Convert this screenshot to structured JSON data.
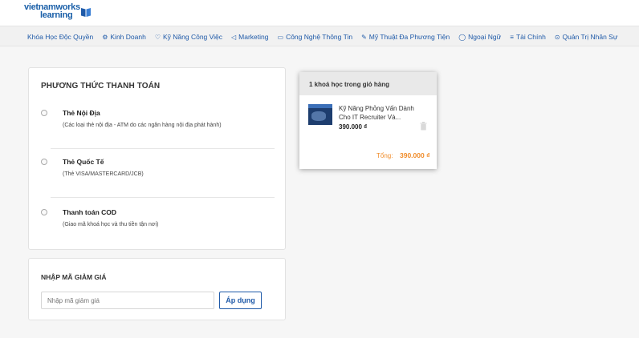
{
  "logo": {
    "line1": "vietnamworks",
    "line2": "learning"
  },
  "nav": {
    "items": [
      {
        "label": "Khóa Học Độc Quyền",
        "icon": ""
      },
      {
        "label": "Kinh Doanh",
        "icon": "⚙"
      },
      {
        "label": "Kỹ Năng Công Việc",
        "icon": "♡"
      },
      {
        "label": "Marketing",
        "icon": "◁"
      },
      {
        "label": "Công Nghệ Thông Tin",
        "icon": "▭"
      },
      {
        "label": "Mỹ Thuật Đa Phương Tiện",
        "icon": "✎"
      },
      {
        "label": "Ngoại Ngữ",
        "icon": "◯"
      },
      {
        "label": "Tài Chính",
        "icon": "≡"
      },
      {
        "label": "Quản Trị Nhân Sự",
        "icon": "⊙"
      }
    ]
  },
  "payment": {
    "title": "PHƯƠNG THỨC THANH TOÁN",
    "options": [
      {
        "label": "Thẻ Nội Địa",
        "desc": "(Các loại thẻ nội địa - ATM do các ngân hàng nội địa phát hành)",
        "selected": false
      },
      {
        "label": "Thẻ Quốc Tế",
        "desc": "(Thẻ VISA/MASTERCARD/JCB)",
        "selected": false
      },
      {
        "label": "Thanh toán COD",
        "desc": "(Giao mã khoá học và thu tiền tận nơi)",
        "selected": false
      }
    ]
  },
  "coupon": {
    "title": "NHẬP MÃ GIẢM GIÁ",
    "placeholder": "Nhập mã giảm giá",
    "button": "Áp dụng"
  },
  "cart": {
    "header": "1 khoá học trong giỏ hàng",
    "item": {
      "title": "Kỹ Năng Phỏng Vấn Dành Cho IT Recruiter Và...",
      "price": "390.000 ₫"
    },
    "total_label": "Tổng:",
    "total_value": "390.000 ₫"
  },
  "colors": {
    "brand": "#1f5aa8",
    "accent": "#f08c2a"
  }
}
